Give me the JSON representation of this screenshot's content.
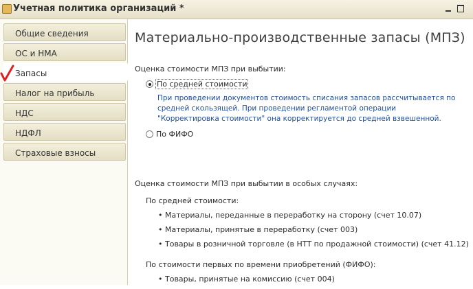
{
  "window": {
    "title": "Учетная политика организаций *"
  },
  "sidebar": {
    "items": [
      {
        "label": "Общие сведения"
      },
      {
        "label": "ОС и НМА"
      },
      {
        "label": "Запасы",
        "active": true
      },
      {
        "label": "Налог на прибыль"
      },
      {
        "label": "НДС"
      },
      {
        "label": "НДФЛ"
      },
      {
        "label": "Страховые взносы"
      }
    ],
    "annotation_color": "#e02020"
  },
  "main": {
    "heading": "Материально-производственные запасы (МПЗ)",
    "valuation": {
      "label": "Оценка стоимости МПЗ при выбытии:",
      "options": [
        {
          "label": "По средней стоимости",
          "selected": true
        },
        {
          "label": "По ФИФО",
          "selected": false
        }
      ],
      "hint": "При проведении документов стоимость списания запасов рассчитывается по средней скользящей. При проведении регламентой операции \"Корректировка стоимости\" она корректируется до средней взвешенной."
    },
    "special": {
      "label": "Оценка стоимости МПЗ при выбытии в  особых случаях:",
      "average": {
        "label": "По средней стоимости:",
        "items": [
          "Материалы, переданные в переработку на сторону (счет 10.07)",
          "Материалы, принятые в переработку (счет 003)",
          "Товары в розничной торговле (в НТТ по продажной стоимости) (счет 41.12)"
        ]
      },
      "fifo": {
        "label": "По стоимости первых по времени приобретений (ФИФО):",
        "items": [
          "Товары, принятые на комиссию (счет 004)"
        ]
      }
    }
  },
  "colors": {
    "hint_text": "#1f4fa0",
    "sidebar_tab": "#ece7d2"
  }
}
